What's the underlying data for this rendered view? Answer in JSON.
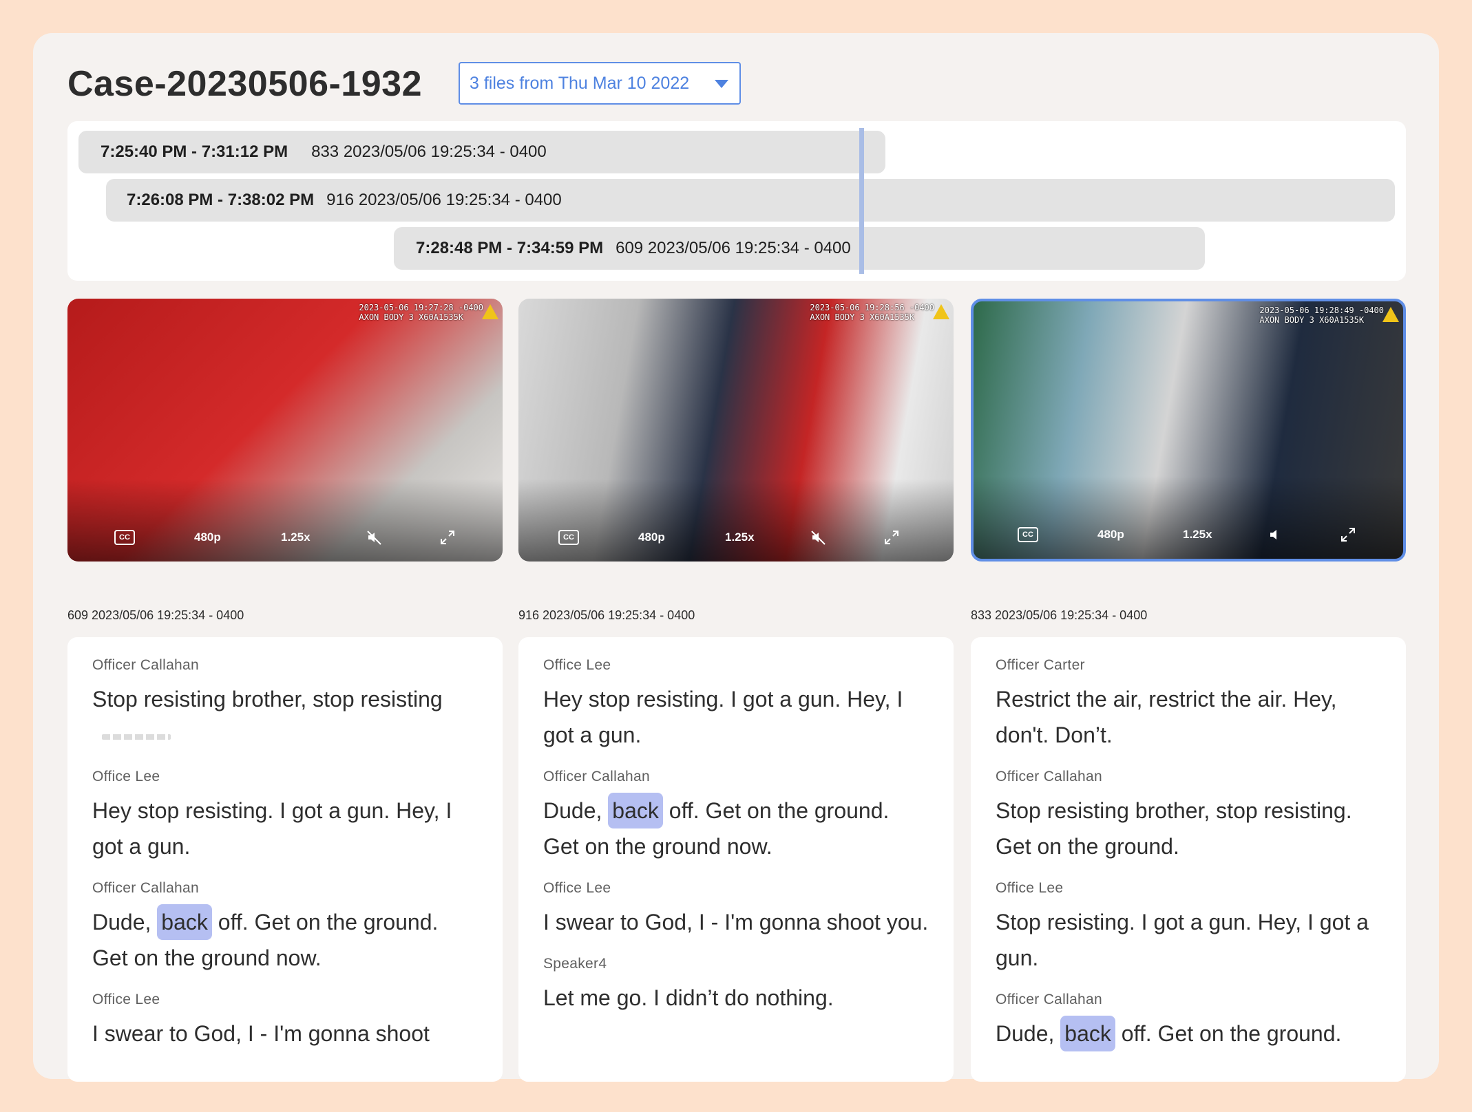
{
  "case": {
    "title": "Case-20230506-1932",
    "files_select": "3 files from Thu Mar 10 2022"
  },
  "timeline": {
    "bars": [
      {
        "range": "7:25:40 PM - 7:31:12 PM",
        "label": "833 2023/05/06 19:25:34 - 0400"
      },
      {
        "range": "7:26:08 PM - 7:38:02 PM",
        "label": "916 2023/05/06 19:25:34 - 0400"
      },
      {
        "range": "7:28:48 PM - 7:34:59 PM",
        "label": "609 2023/05/06 19:25:34 - 0400"
      }
    ]
  },
  "videos": [
    {
      "stamp1": "2023-05-06 19:27:28 -0400",
      "stamp2": "AXON BODY 3 X60A1535K",
      "cc": "CC",
      "quality": "480p",
      "speed": "1.25x",
      "caption": "609 2023/05/06 19:25:34 - 0400",
      "audio_icon": "muted-speaker-icon",
      "selected": false
    },
    {
      "stamp1": "2023-05-06 19:28:56 -0400",
      "stamp2": "AXON BODY 3 X60A1535K",
      "cc": "CC",
      "quality": "480p",
      "speed": "1.25x",
      "caption": "916 2023/05/06 19:25:34 - 0400",
      "audio_icon": "muted-speaker-icon",
      "selected": false
    },
    {
      "stamp1": "2023-05-06 19:28:49 -0400",
      "stamp2": "AXON BODY 3 X60A1535K",
      "cc": "CC",
      "quality": "480p",
      "speed": "1.25x",
      "caption": "833 2023/05/06 19:25:34 - 0400",
      "audio_icon": "speaker-icon",
      "selected": true
    }
  ],
  "transcripts": [
    [
      {
        "speaker": "Officer Callahan",
        "text": "Stop resisting brother, stop resisting"
      },
      {
        "speaker": "Office Lee",
        "text": "Hey stop resisting. I got a gun. Hey, I got a gun."
      },
      {
        "speaker": "Officer Callahan",
        "pre": "Dude, ",
        "hl": "back",
        "post": " off. Get on the ground. Get on the ground now."
      },
      {
        "speaker": "Office Lee",
        "text": "I swear to God, I - I'm gonna shoot"
      }
    ],
    [
      {
        "speaker": "Office Lee",
        "text": "Hey stop resisting. I got a gun. Hey, I got a gun."
      },
      {
        "speaker": "Officer Callahan",
        "pre": "Dude, ",
        "hl": "back",
        "post": " off. Get on the ground. Get on the ground now."
      },
      {
        "speaker": "Office Lee",
        "text": "I swear to God, I - I'm gonna shoot you."
      },
      {
        "speaker": "Speaker4",
        "text": "Let me go. I didn’t do nothing."
      }
    ],
    [
      {
        "speaker": "Officer Carter",
        "text": "Restrict the air, restrict the air. Hey, don't. Don’t."
      },
      {
        "speaker": "Officer Callahan",
        "text": "Stop resisting brother, stop resisting. Get on the ground."
      },
      {
        "speaker": "Office Lee",
        "text": "Stop resisting. I got a gun. Hey, I got a gun."
      },
      {
        "speaker": "Officer Callahan",
        "pre": "Dude, ",
        "hl": "back",
        "post": " off. Get on the ground."
      }
    ]
  ],
  "colors": {
    "accent": "#5f8ee6",
    "highlight": "#b5bff2",
    "frame_background": "#fde1cc"
  }
}
